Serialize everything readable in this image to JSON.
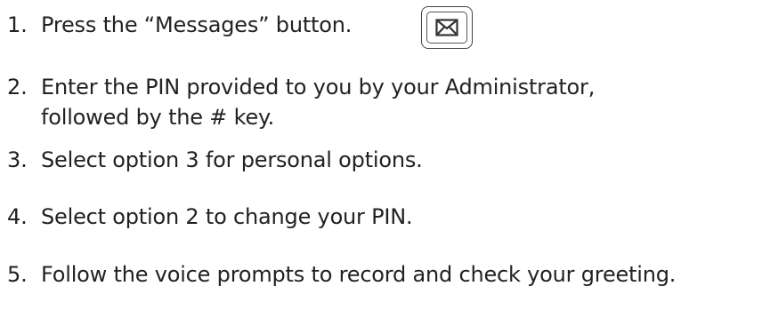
{
  "steps": [
    {
      "number": "1.",
      "text": "Press the “Messages” button."
    },
    {
      "number": "2.",
      "text": "Enter the PIN provided to you by your Administrator,",
      "text_line2": "followed by the # key."
    },
    {
      "number": "3.",
      "text": "Select option 3 for personal options."
    },
    {
      "number": "4.",
      "text": "Select option 2 to change your PIN."
    },
    {
      "number": "5.",
      "text": "Follow the voice prompts to record and check your greeting."
    }
  ],
  "icons": {
    "messages_button": "envelope-icon"
  },
  "colors": {
    "text": "#222222",
    "icon_stroke": "#333333"
  }
}
